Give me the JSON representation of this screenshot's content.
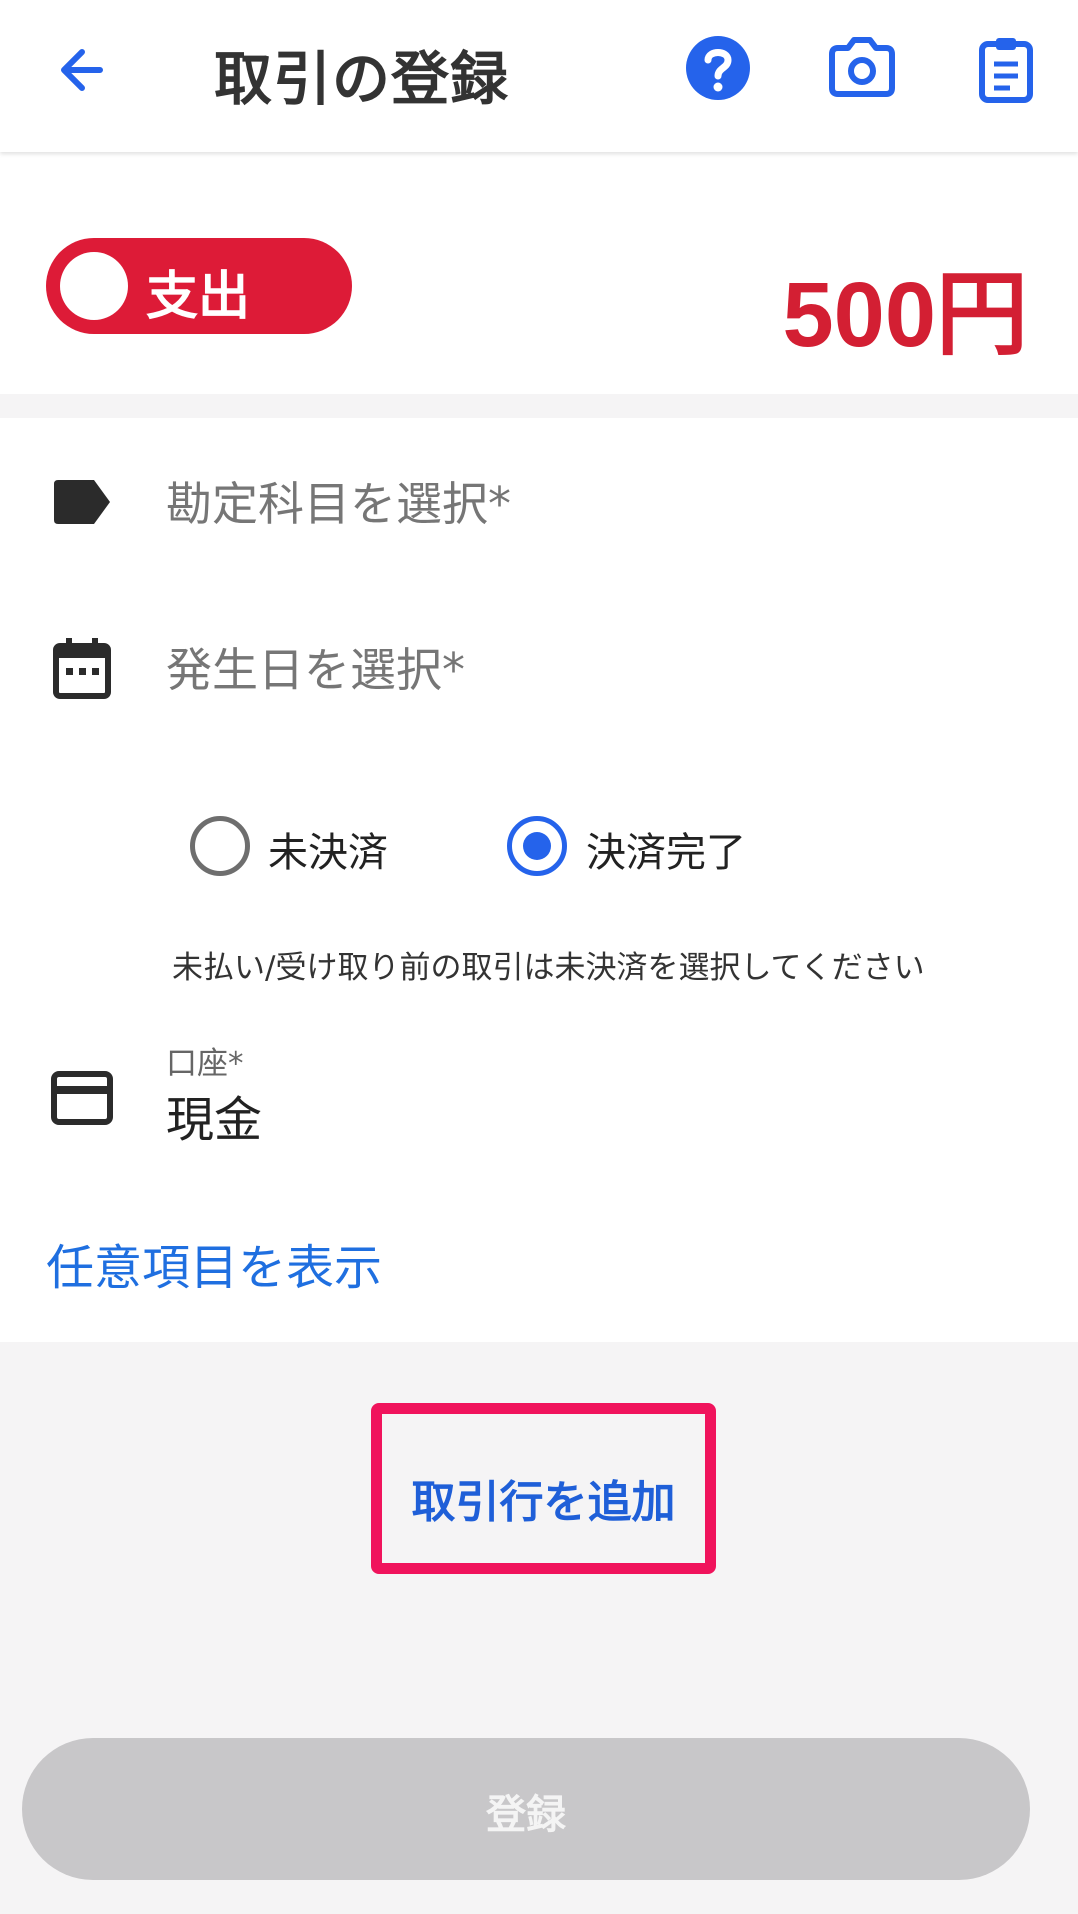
{
  "header": {
    "title": "取引の登録"
  },
  "transaction": {
    "type_label": "支出",
    "amount": "500円",
    "type_color": "#dd1b37",
    "amount_color": "#d31f33"
  },
  "fields": {
    "account_item_placeholder": "勘定科目を選択*",
    "date_placeholder": "発生日を選択*"
  },
  "settlement": {
    "options": [
      "未決済",
      "決済完了"
    ],
    "selected": "決済完了",
    "hint": "未払い/受け取り前の取引は未決済を選択してください"
  },
  "account": {
    "label": "口座*",
    "value": "現金"
  },
  "links": {
    "show_optional": "任意項目を表示",
    "add_row": "取引行を追加"
  },
  "buttons": {
    "register": "登録"
  },
  "colors": {
    "accent": "#2563eb",
    "highlight_border": "#f0135c",
    "disabled_button": "#c8c7c9"
  },
  "icons": [
    "back-arrow-icon",
    "help-icon",
    "camera-icon",
    "clipboard-icon",
    "tag-icon",
    "calendar-icon",
    "credit-card-icon"
  ]
}
